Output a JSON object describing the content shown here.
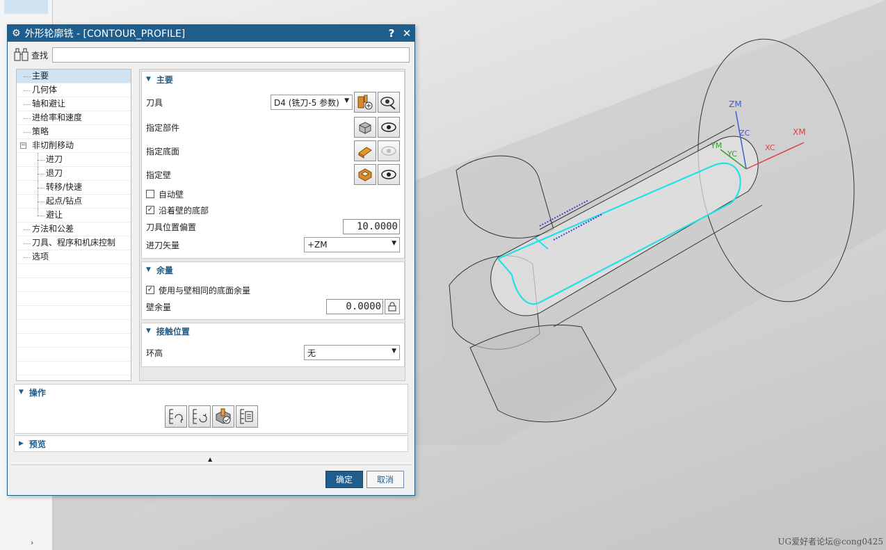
{
  "dialog": {
    "title": "外形轮廓铣 - [CONTOUR_PROFILE]",
    "help": "?",
    "close": "✕",
    "search_label": "查找",
    "search_value": ""
  },
  "tree": [
    {
      "label": "主要",
      "level": 0,
      "selected": true
    },
    {
      "label": "几何体",
      "level": 0
    },
    {
      "label": "轴和避让",
      "level": 0
    },
    {
      "label": "进给率和速度",
      "level": 0
    },
    {
      "label": "策略",
      "level": 0
    },
    {
      "label": "非切削移动",
      "level": 0,
      "expanded": true
    },
    {
      "label": "进刀",
      "level": 1
    },
    {
      "label": "退刀",
      "level": 1
    },
    {
      "label": "转移/快速",
      "level": 1
    },
    {
      "label": "起点/钻点",
      "level": 1
    },
    {
      "label": "避让",
      "level": 1
    },
    {
      "label": "方法和公差",
      "level": 0
    },
    {
      "label": "刀具、程序和机床控制",
      "level": 0
    },
    {
      "label": "选项",
      "level": 0
    }
  ],
  "main_group": {
    "title": "主要",
    "tool_label": "刀具",
    "tool_value": "D4 (铣刀-5 参数)",
    "part_label": "指定部件",
    "floor_label": "指定底面",
    "wall_label": "指定壁",
    "auto_wall_label": "自动壁",
    "auto_wall_checked": false,
    "along_wall_label": "沿着壁的底部",
    "along_wall_checked": true,
    "tool_offset_label": "刀具位置偏置",
    "tool_offset_value": "10.0000",
    "feed_vector_label": "进刀矢量",
    "feed_vector_value": "+ZM"
  },
  "stock_group": {
    "title": "余量",
    "same_stock_label": "使用与壁相同的底面余量",
    "same_stock_checked": true,
    "wall_stock_label": "壁余量",
    "wall_stock_value": "0.0000"
  },
  "contact_group": {
    "title": "接触位置",
    "ring_label": "环高",
    "ring_value": "无"
  },
  "ops_group": {
    "title": "操作"
  },
  "preview_group": {
    "title": "预览"
  },
  "buttons": {
    "ok": "确定",
    "cancel": "取消"
  },
  "viewport": {
    "axes": {
      "zm": "ZM",
      "zc": "ZC",
      "xm": "XM",
      "xc": "XC",
      "ym": "YM",
      "yc": "YC"
    },
    "watermark": "UG爱好者论坛@cong0425"
  },
  "colors": {
    "accent": "#1f5e8c",
    "toolpath": "#22e0e6"
  }
}
